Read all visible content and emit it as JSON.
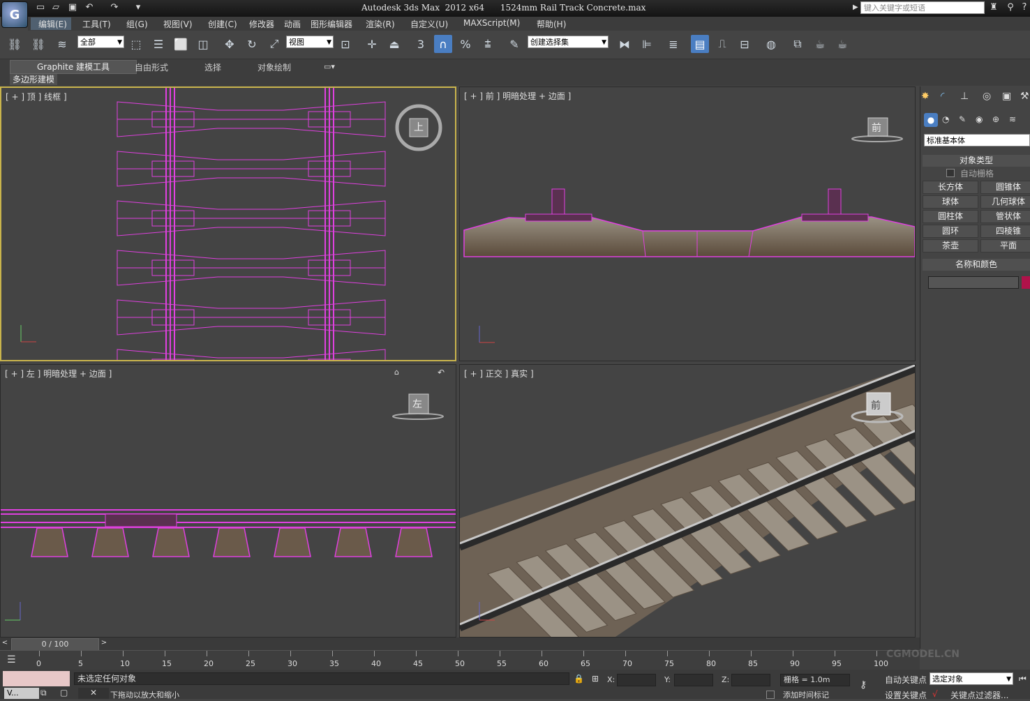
{
  "app": {
    "title": "Autodesk 3ds Max  2012 x64      1524mm Rail Track Concrete.max",
    "search_placeholder": "键入关键字或短语",
    "logo_glyph": "G"
  },
  "quick_access": [
    "new-icon",
    "open-icon",
    "save-icon",
    "undo-icon",
    "redo-icon",
    "dropdown-icon"
  ],
  "menu": [
    "编辑(E)",
    "工具(T)",
    "组(G)",
    "视图(V)",
    "创建(C)",
    "修改器",
    "动画",
    "图形编辑器",
    "渲染(R)",
    "自定义(U)",
    "MAXScript(M)",
    "帮助(H)"
  ],
  "toolbar": {
    "selection_filter": "全部",
    "ref_coord": "视图",
    "named_selection": "创建选择集",
    "snap_labels": {
      "snap": "3",
      "angle": "%"
    }
  },
  "ribbon": {
    "tabs": [
      "Graphite 建模工具",
      "自由形式",
      "选择",
      "对象绘制"
    ],
    "sub_tab": "多边形建模"
  },
  "viewports": {
    "top": {
      "label": "[ + ] 顶 ] 线框 ]",
      "cube": "上"
    },
    "front": {
      "label": "[ + ] 前 ] 明暗处理 + 边面 ]",
      "cube": "前"
    },
    "left": {
      "label": "[ + ] 左 ] 明暗处理 + 边面 ]",
      "cube": "左"
    },
    "ortho": {
      "label": "[ + ] 正交 ] 真实 ]",
      "cube": "前"
    }
  },
  "command_panel": {
    "category": "标准基本体",
    "object_type_header": "对象类型",
    "autogrid": "自动栅格",
    "buttons": [
      "长方体",
      "圆锥体",
      "球体",
      "几何球体",
      "圆柱体",
      "管状体",
      "圆环",
      "四棱锥",
      "茶壶",
      "平面"
    ],
    "name_color_header": "名称和颜色",
    "name_value": "",
    "object_color": "#b0124a"
  },
  "timeline": {
    "frame": "0 / 100",
    "ticks": [
      "0",
      "5",
      "10",
      "15",
      "20",
      "25",
      "30",
      "35",
      "40",
      "45",
      "50",
      "55",
      "60",
      "65",
      "70",
      "75",
      "80",
      "85",
      "90",
      "95",
      "100"
    ]
  },
  "status": {
    "selection": "未选定任何对象",
    "prompt": "下拖动以放大和缩小",
    "x_label": "X:",
    "y_label": "Y:",
    "z_label": "Z:",
    "grid": "栅格 = 1.0m",
    "auto_key": "自动关键点",
    "set_key": "设置关键点",
    "selected_dropdown": "选定对象",
    "key_filters": "关键点过滤器...",
    "add_time_tag": "添加时间标记",
    "taskbar_item": "V...",
    "watermark": "CGMODEL.CN"
  },
  "colors": {
    "wire": "#e040e0",
    "selected_border": "#c9b44c",
    "active_tool": "#4a7ec2"
  }
}
